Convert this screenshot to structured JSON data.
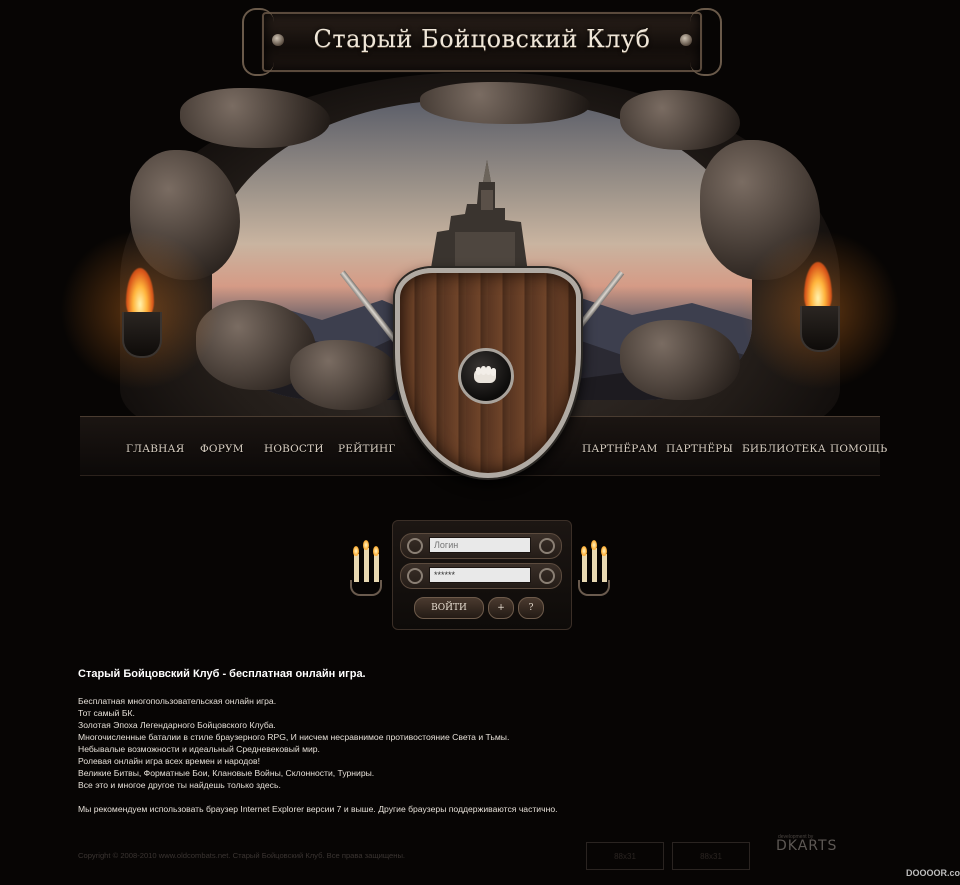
{
  "header": {
    "title": "Старый Бойцовский Клуб"
  },
  "nav": {
    "left": [
      "ГЛАВНАЯ",
      "ФОРУМ",
      "НОВОСТИ",
      "РЕЙТИНГ"
    ],
    "right": [
      "ПАРТНЁРАМ",
      "ПАРТНЁРЫ",
      "БИБЛИОТЕКА",
      "ПОМОЩЬ"
    ]
  },
  "login": {
    "login_placeholder": "Логин",
    "password_value": "******",
    "enter_label": "ВОЙТИ",
    "register_label": "+",
    "help_label": "?"
  },
  "intro": {
    "heading": "Старый Бойцовский Клуб - бесплатная онлайн игра.",
    "lines": [
      "Бесплатная многопользовательская онлайн игра.",
      "Тот самый БК.",
      "Золотая Эпоха Легендарного Бойцовского Клуба.",
      "Многочисленные баталии в стиле браузерного RPG, И нисчем несравнимое противостояние Света и Тьмы.",
      "Небывалые возможности и идеальный Средневековый мир.",
      "Ролевая онлайн игра всех времен и народов!",
      "Великие Битвы, Форматные Бои, Клановые Войны, Склонности, Турниры.",
      "Все это и многое другое ты найдешь только здесь."
    ],
    "browser_note": "Мы рекомендуем использовать браузер Internet Explorer версии 7 и выше. Другие браузеры поддерживаются частично."
  },
  "footer": {
    "copyright": "Copyright © 2008-2010 www.oldcombats.net. Старый Бойцовский Клуб. Все права защищены.",
    "counter1": "88x31",
    "counter2": "88x31",
    "dev_small": "development by",
    "dev_mark": "DKARTS",
    "watermark": "DOOOOR.com"
  },
  "icons": {
    "fist": "fist-icon",
    "knot": "celtic-knot-icon"
  }
}
